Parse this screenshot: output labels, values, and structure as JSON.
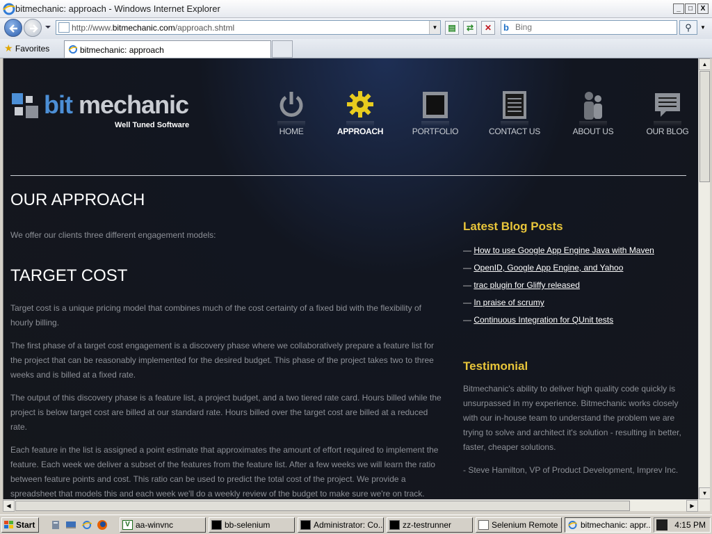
{
  "window": {
    "title": "bitmechanic: approach - Windows Internet Explorer",
    "minimize": "_",
    "maximize": "□",
    "close": "X"
  },
  "address_bar": {
    "url_prefix": "http://www.",
    "url_domain": "bitmechanic.com",
    "url_path": "/approach.shtml"
  },
  "search": {
    "placeholder": "Bing"
  },
  "favorites": {
    "label": "Favorites"
  },
  "tab": {
    "title": "bitmechanic: approach"
  },
  "site": {
    "logo": {
      "word1": "bit",
      "word2": "mechanic",
      "tagline": "Well Tuned Software"
    },
    "nav": [
      {
        "label": "HOME",
        "icon": "power-icon",
        "active": false
      },
      {
        "label": "APPROACH",
        "icon": "gear-icon",
        "active": true
      },
      {
        "label": "PORTFOLIO",
        "icon": "frame-icon",
        "active": false
      },
      {
        "label": "CONTACT US",
        "icon": "notepad-icon",
        "active": false
      },
      {
        "label": "ABOUT US",
        "icon": "people-icon",
        "active": false
      },
      {
        "label": "OUR BLOG",
        "icon": "speech-bubble-icon",
        "active": false
      }
    ]
  },
  "main": {
    "title": "OUR APPROACH",
    "intro": "We offer our clients three different engagement models:",
    "section_title": "TARGET COST",
    "paragraphs": [
      "Target cost is a unique pricing model that combines much of the cost certainty of a fixed bid with the flexibility of hourly billing.",
      "The first phase of a target cost engagement is a discovery phase where we collaboratively prepare a feature list for the project that can be reasonably implemented for the desired budget. This phase of the project takes two to three weeks and is billed at a fixed rate.",
      "The output of this discovery phase is a feature list, a project budget, and a two tiered rate card. Hours billed while the project is below target cost are billed at our standard rate. Hours billed over the target cost are billed at a reduced rate.",
      "Each feature in the list is assigned a point estimate that approximates the amount of effort required to implement the feature. Each week we deliver a subset of the features from the feature list. After a few weeks we will learn the ratio between feature points and cost. This ratio can be used to predict the total cost of the project. We provide a spreadsheet that models this and each week we'll do a weekly review of the budget to make sure we're on track."
    ]
  },
  "sidebar": {
    "blog_title": "Latest Blog Posts",
    "dash": "—",
    "posts": [
      "How to use Google App Engine Java with Maven",
      "OpenID, Google App Engine, and Yahoo",
      "trac plugin for Gliffy released",
      "In praise of scrumy",
      "Continuous Integration for QUnit tests"
    ],
    "testimonial_title": "Testimonial",
    "testimonial_text": "Bitmechanic's ability to deliver high quality code quickly is unsurpassed in my experience. Bitmechanic works closely with our in-house team to understand the problem we are trying to solve and architect it's solution - resulting in better, faster, cheaper solutions.",
    "testimonial_author": "- Steve Hamilton, VP of Product Development, Imprev Inc."
  },
  "taskbar": {
    "start": "Start",
    "buttons": [
      {
        "label": "aa-winvnc",
        "icon": "vnc-icon"
      },
      {
        "label": "bb-selenium",
        "icon": "console-icon"
      },
      {
        "label": "Administrator: Co...",
        "icon": "console-icon"
      },
      {
        "label": "zz-testrunner",
        "icon": "console-icon"
      },
      {
        "label": "Selenium Remote ...",
        "icon": "page-icon"
      },
      {
        "label": "bitmechanic: appr...",
        "icon": "ie-icon"
      }
    ],
    "clock": "4:15 PM"
  }
}
